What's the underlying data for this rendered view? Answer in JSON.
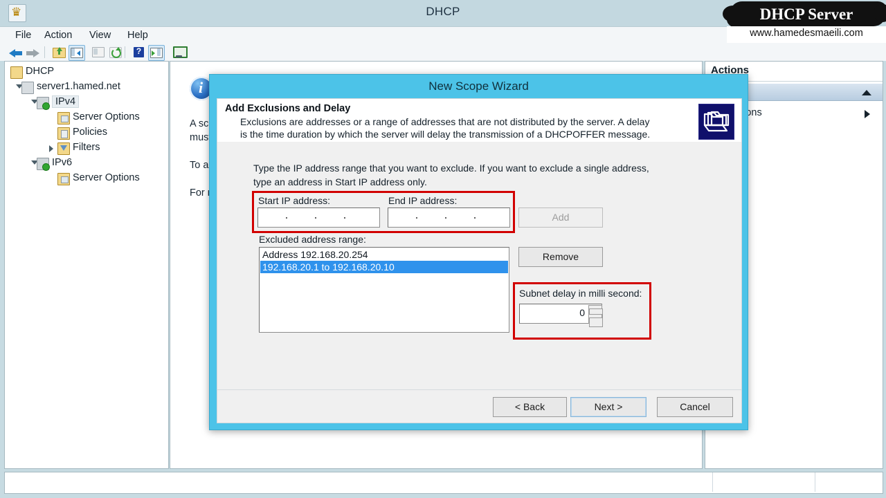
{
  "window": {
    "title": "DHCP",
    "app_icon": "dhcp-server-icon"
  },
  "menu": {
    "items": [
      {
        "label": "File"
      },
      {
        "label": "Action"
      },
      {
        "label": "View"
      },
      {
        "label": "Help"
      }
    ]
  },
  "toolbar": {
    "items": [
      {
        "name": "back-icon",
        "label": "Back"
      },
      {
        "name": "forward-icon",
        "label": "Forward"
      },
      {
        "name": "up-one-level-icon",
        "label": "Up One Level"
      },
      {
        "name": "show-hide-console-tree-icon",
        "label": "Show/Hide Console Tree"
      },
      {
        "name": "properties-icon",
        "label": "Properties"
      },
      {
        "name": "refresh-icon",
        "label": "Refresh"
      },
      {
        "name": "help-icon",
        "label": "Help"
      },
      {
        "name": "show-hide-action-pane-icon",
        "label": "Show/Hide Action Pane"
      },
      {
        "name": "export-list-icon",
        "label": "Export List"
      }
    ]
  },
  "tree": {
    "nodes": [
      {
        "label": "DHCP",
        "icon": "dhcp-root-icon",
        "indent": 0,
        "twisty": "none",
        "selected": false
      },
      {
        "label": "server1.hamed.net",
        "icon": "server-icon",
        "indent": 1,
        "twisty": "open",
        "selected": false
      },
      {
        "label": "IPv4",
        "icon": "ipv4-icon",
        "indent": 2,
        "twisty": "open",
        "selected": true
      },
      {
        "label": "Server Options",
        "icon": "server-options-icon",
        "indent": 3,
        "twisty": "none",
        "selected": false
      },
      {
        "label": "Policies",
        "icon": "policies-icon",
        "indent": 3,
        "twisty": "none",
        "selected": false
      },
      {
        "label": "Filters",
        "icon": "filters-icon",
        "indent": 3,
        "twisty": "closed",
        "selected": false
      },
      {
        "label": "IPv6",
        "icon": "ipv6-icon",
        "indent": 2,
        "twisty": "open",
        "selected": false
      },
      {
        "label": "Server Options",
        "icon": "server-options-icon",
        "indent": 3,
        "twisty": "none",
        "selected": false
      }
    ]
  },
  "middle_pane": {
    "info_icon": "information-icon",
    "lines": [
      "A sco",
      "must",
      "To ad",
      "For m"
    ]
  },
  "actions_pane": {
    "title": "Actions",
    "group_collapse_icon": "chevron-up-icon",
    "more_actions": "ore Actions",
    "more_actions_icon": "chevron-right-icon"
  },
  "dialog": {
    "title": "New Scope Wizard",
    "header": {
      "heading": "Add Exclusions and Delay",
      "line1": "Exclusions are addresses or a range of addresses that are not distributed by the server. A delay",
      "line2": "is the time duration by which the server will delay the transmission of a DHCPOFFER message.",
      "icon": "folder-stack-icon"
    },
    "body": {
      "intro_line1": "Type the IP address range that you want to exclude. If you want to exclude a single address,",
      "intro_line2": "type an address in Start IP address only.",
      "start_ip_label": "Start IP address:",
      "start_ip_value": "",
      "end_ip_label": "End IP address:",
      "end_ip_value": "",
      "add_button": "Add",
      "add_button_enabled": false,
      "excluded_label": "Excluded address range:",
      "excluded_items": [
        {
          "text": "Address 192.168.20.254",
          "selected": false
        },
        {
          "text": "192.168.20.1 to 192.168.20.10",
          "selected": true
        }
      ],
      "remove_button": "Remove",
      "subnet_delay_label": "Subnet delay in milli second:",
      "subnet_delay_value": "0",
      "spin_up_icon": "spinner-up-icon",
      "spin_down_icon": "spinner-down-icon"
    },
    "footer": {
      "back_button": "< Back",
      "next_button": "Next >",
      "cancel_button": "Cancel"
    }
  },
  "watermark": {
    "title": "DHCP Server",
    "url": "www.hamedesmaeili.com"
  },
  "colors": {
    "dialog_border": "#4cc3e8",
    "highlight_red": "#d10000",
    "selection_blue": "#2f92ec",
    "window_chrome": "#c3d8e0"
  }
}
